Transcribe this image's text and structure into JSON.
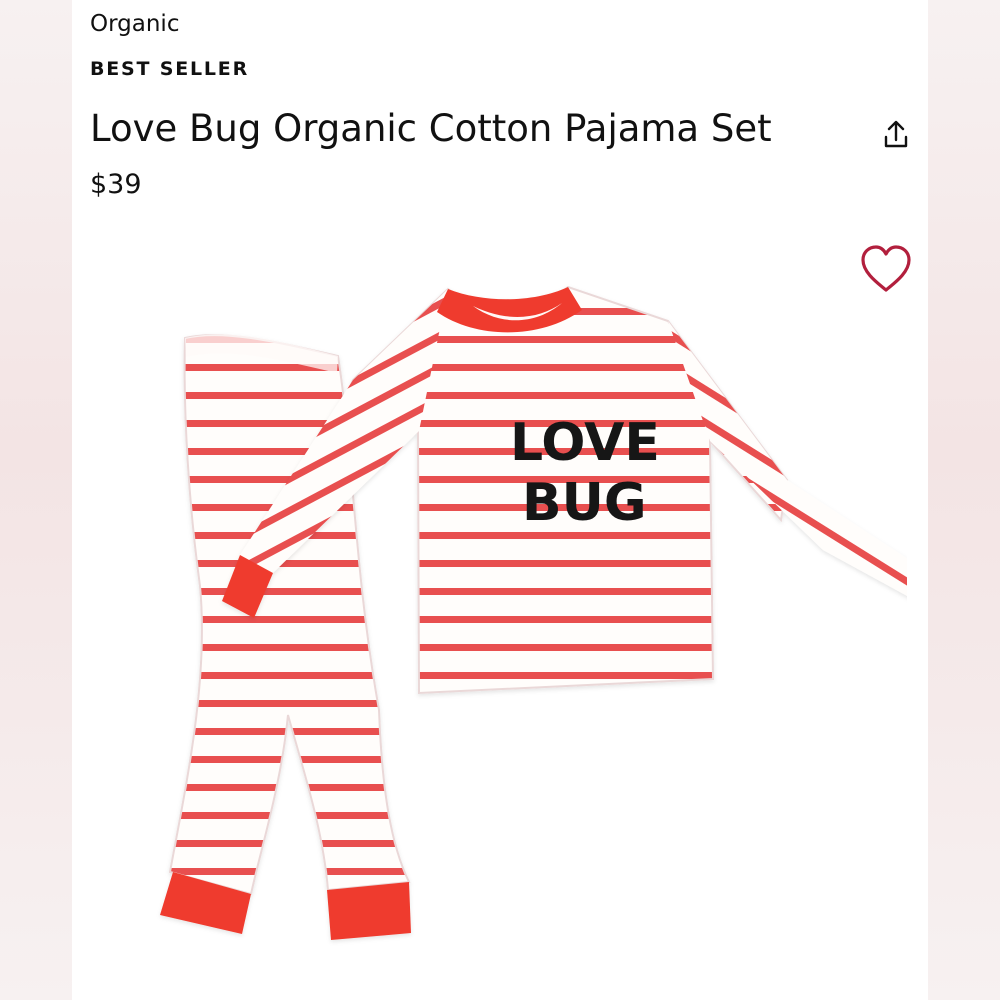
{
  "product": {
    "category": "Organic",
    "badge": "BEST SELLER",
    "title": "Love Bug Organic Cotton Pajama Set",
    "price": "$39",
    "image_print_text": [
      "LOVE",
      "BUG"
    ]
  },
  "actions": {
    "share_icon": "share-icon",
    "favorite_icon": "heart-outline-icon"
  },
  "colors": {
    "stripe_red": "#e84f4f",
    "cuff_red": "#ef3b2e",
    "heart_red": "#b21f3d",
    "text": "#111111"
  }
}
